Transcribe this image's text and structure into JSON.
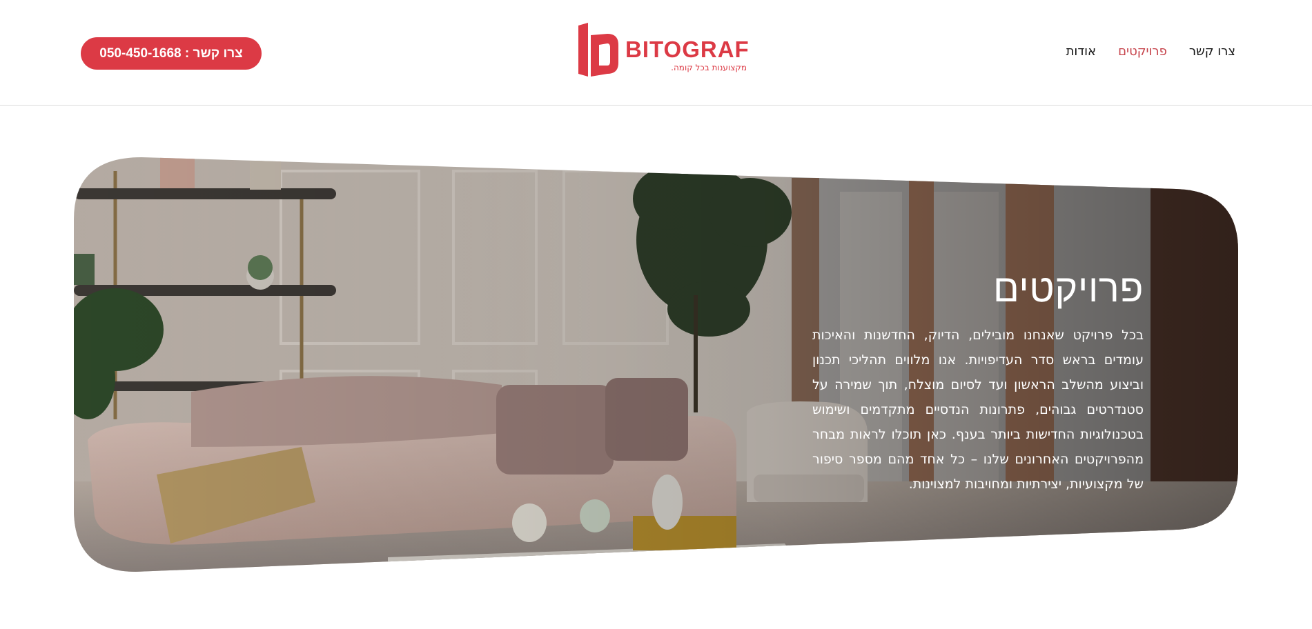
{
  "header": {
    "cta_label": "צרו קשר : 050-450-1668",
    "logo": {
      "name": "BITOGRAF",
      "tagline": "מקצוענות בכל קומה."
    },
    "nav": [
      {
        "label": "אודות",
        "active": false
      },
      {
        "label": "פרויקטים",
        "active": true
      },
      {
        "label": "צרו קשר",
        "active": false
      }
    ]
  },
  "hero": {
    "title": "פרויקטים",
    "body": "בכל פרויקט שאנחנו מובילים, הדיוק, החדשנות והאיכות עומדים בראש סדר העדיפויות. אנו מלווים תהליכי תכנון וביצוע מהשלב הראשון ועד לסיום מוצלח, תוך שמירה על סטנדרטים גבוהים, פתרונות הנדסיים מתקדמים ושימוש בטכנולוגיות החדישות ביותר בענף. כאן תוכלו לראות מבחר מהפרויקטים האחרונים שלנו – כל אחד מהם מספר סיפור של מקצועיות, יצירתיות ומחויבות למצוינות."
  },
  "colors": {
    "accent": "#dc3a45",
    "nav_active": "#c6424a",
    "divider": "#dcdcdc"
  }
}
